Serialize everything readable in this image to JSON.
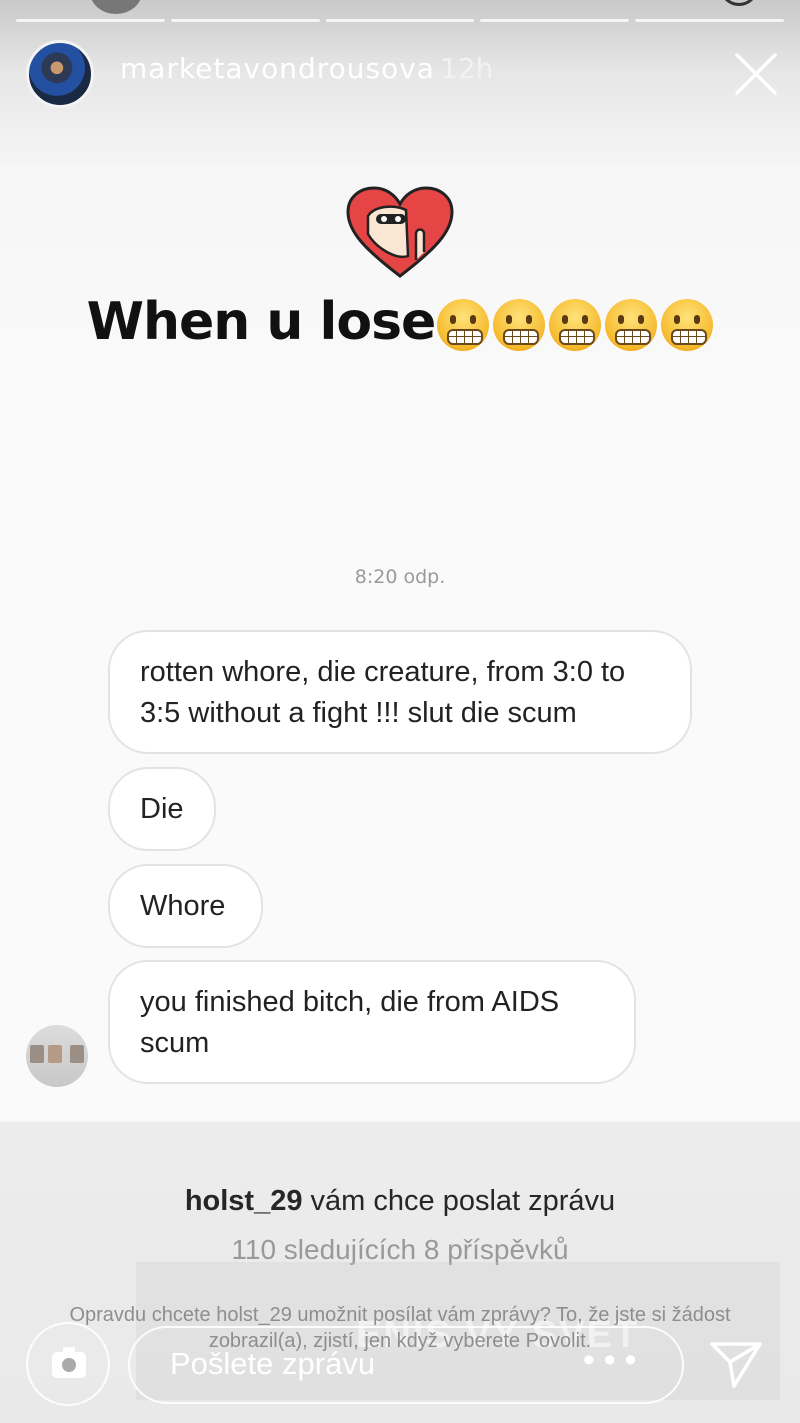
{
  "story": {
    "progress_segments": 5,
    "username": "marketavondrousova",
    "time": "12h",
    "close_icon": "close-icon",
    "sticker": "heart-sticker",
    "caption": "When u lose",
    "caption_emoji": "grimacing-face-emoji",
    "caption_emoji_count": 5
  },
  "conversation": {
    "timestamp": "8:20 odp.",
    "messages": [
      "rotten whore, die creature, from 3:0 to 3:5 without a fight !!! slut die scum",
      "Die",
      "Whore",
      "you finished bitch, die from AIDS scum"
    ]
  },
  "request": {
    "username": "holst_29",
    "text": " vám chce poslat zprávu",
    "stats": "110 sledujících 8 příspěvků",
    "note": "Opravdu chcete holst_29 umožnit posílat vám zprávy? To, že jste si žádost zobrazil(a), zjistí, jen když vyberete Povolit."
  },
  "reply_bar": {
    "placeholder": "Pošlete zprávu",
    "more": "•••",
    "camera_icon": "camera-icon",
    "send_icon": "send-icon"
  },
  "watermark": "ENIS.VY SVET"
}
